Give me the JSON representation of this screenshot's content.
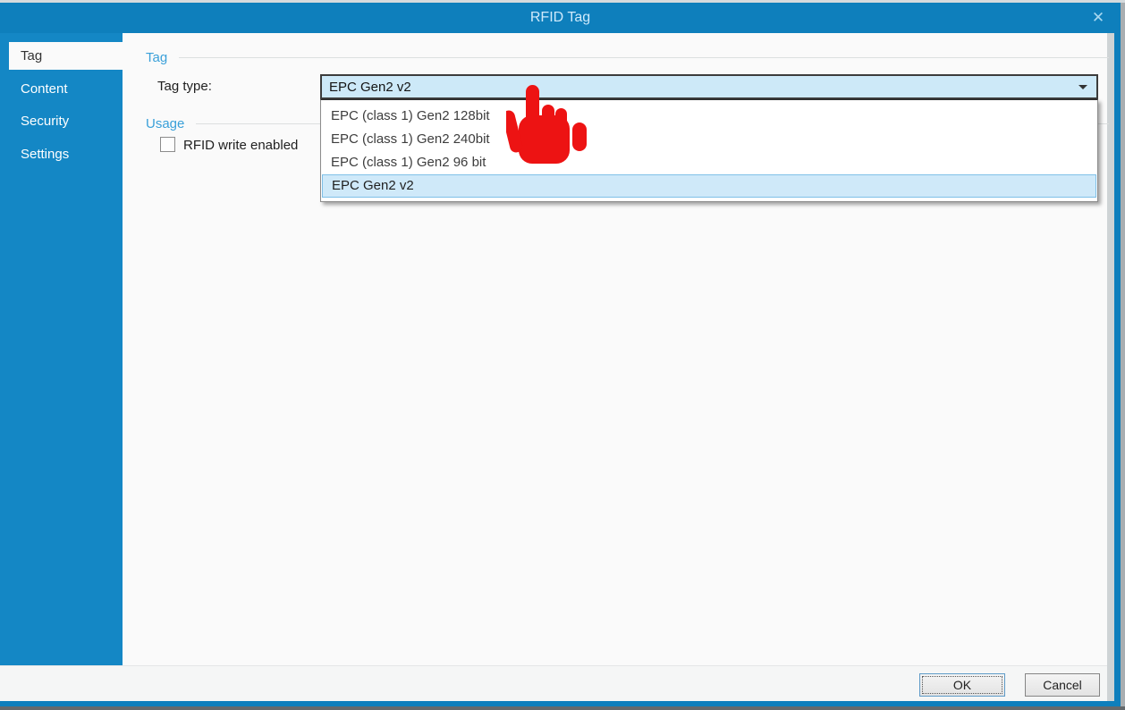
{
  "window": {
    "title": "RFID Tag",
    "close_glyph": "✕"
  },
  "sidebar": {
    "items": [
      {
        "label": "Tag",
        "selected": true
      },
      {
        "label": "Content",
        "selected": false
      },
      {
        "label": "Security",
        "selected": false
      },
      {
        "label": "Settings",
        "selected": false
      }
    ]
  },
  "main": {
    "tag_group": {
      "title": "Tag",
      "tag_type_label": "Tag type:",
      "tag_type_value": "EPC Gen2 v2"
    },
    "dropdown": {
      "options": [
        "EPC (class 1) Gen2 128bit",
        "EPC (class 1) Gen2 240bit",
        "EPC (class 1) Gen2 96 bit",
        "EPC Gen2 v2"
      ],
      "highlighted_index": 3
    },
    "usage_group": {
      "title": "Usage",
      "checkbox_label": "RFID write enabled",
      "checkbox_checked": false
    }
  },
  "footer": {
    "ok_label": "OK",
    "cancel_label": "Cancel"
  },
  "cursor": {
    "type": "red-hand-pointer",
    "color": "#ed1313"
  },
  "colors": {
    "titlebar_blue": "#0e7fbc",
    "sidebar_blue": "#1487c5",
    "group_header_blue": "#3aa0d9",
    "combobox_highlight": "#cde9f8",
    "list_highlight": "#cfe9f9",
    "content_background": "#fafafa"
  }
}
